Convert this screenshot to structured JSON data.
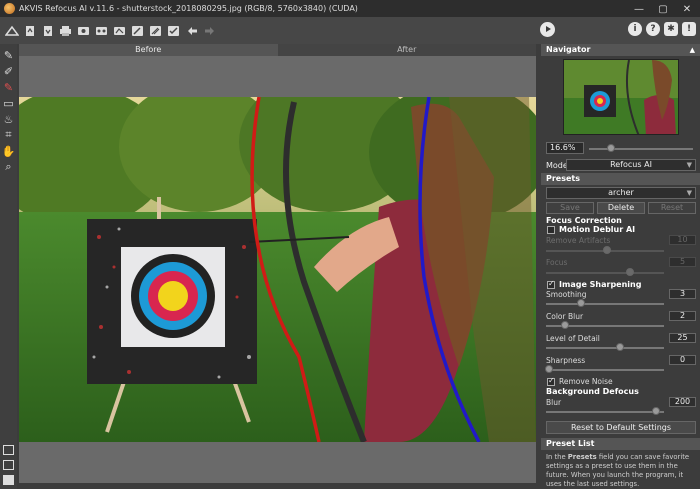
{
  "window": {
    "title": "AKVIS Refocus AI v.11.6 - shutterstock_2018080295.jpg (RGB/8, 5760x3840) (CUDA)",
    "buttons": [
      "—",
      "▢",
      "✕"
    ]
  },
  "toolbar": {
    "icons": [
      "home-icon",
      "open-icon",
      "save-icon",
      "print-icon",
      "share-icon",
      "batch-icon",
      "batch2-icon",
      "brush-icon",
      "brush2-icon",
      "brush3-icon",
      "undo-icon",
      "redo-icon"
    ],
    "right_icons": [
      "info-icon",
      "help-icon",
      "settings-icon",
      "news-icon"
    ]
  },
  "lefttools": [
    "focus-brush-icon",
    "focus-area-icon",
    "background-brush-icon",
    "eraser-icon",
    "history-brush-icon",
    "crop-icon",
    "hand-icon",
    "zoom-icon"
  ],
  "tabs": {
    "before": "Before",
    "after": "After"
  },
  "navigator": {
    "title": "Navigator",
    "zoom": "16.6%"
  },
  "mode": {
    "label": "Mode:",
    "value": "Refocus AI"
  },
  "presets": {
    "title": "Presets",
    "selected": "archer",
    "save": "Save",
    "delete": "Delete",
    "reset": "Reset"
  },
  "focus_correction": {
    "title": "Focus Correction",
    "motion_deblur": "Motion Deblur AI",
    "remove_artifacts": {
      "label": "Remove Artifacts",
      "value": "10"
    },
    "focus": {
      "label": "Focus",
      "value": "5"
    },
    "image_sharpening": "Image Sharpening",
    "smoothing": {
      "label": "Smoothing",
      "value": "3"
    },
    "color_blur": {
      "label": "Color Blur",
      "value": "2"
    },
    "level_of_detail": {
      "label": "Level of Detail",
      "value": "25"
    },
    "sharpness": {
      "label": "Sharpness",
      "value": "0"
    },
    "remove_noise": "Remove Noise"
  },
  "background_defocus": {
    "title": "Background Defocus",
    "blur": {
      "label": "Blur",
      "value": "200"
    }
  },
  "reset_default": "Reset to Default Settings",
  "preset_list": {
    "title": "Preset List",
    "text_pre": "In the ",
    "text_bold": "Presets",
    "text_post": " field you can save favorite settings as a preset to use them in the future. When you launch the program, it uses the last used settings."
  },
  "colors": {
    "panel": "#3c3c3c",
    "accent": "#e8e8e8"
  }
}
